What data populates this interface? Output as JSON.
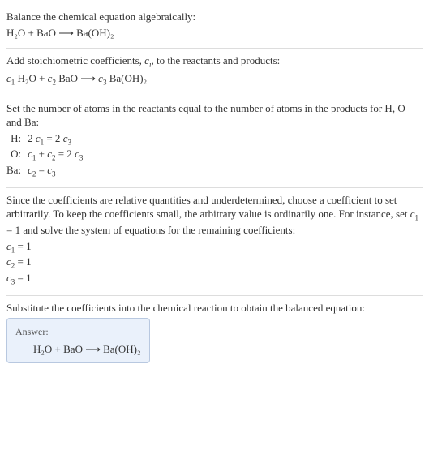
{
  "s1": {
    "prompt": "Balance the chemical equation algebraically:",
    "eqn": "H₂O + BaO ⟶ Ba(OH)₂"
  },
  "s2": {
    "line1a": "Add stoichiometric coefficients, ",
    "ci": "c",
    "ci_sub": "i",
    "line1b": ", to the reactants and products:",
    "eqn_c1": "c",
    "eqn_c1s": "1",
    "eqn_t1": " H₂O + ",
    "eqn_c2": "c",
    "eqn_c2s": "2",
    "eqn_t2": " BaO ⟶ ",
    "eqn_c3": "c",
    "eqn_c3s": "3",
    "eqn_t3": " Ba(OH)₂"
  },
  "s3": {
    "intro": "Set the number of atoms in the reactants equal to the number of atoms in the products for H, O and Ba:",
    "rows": [
      {
        "el": "H:",
        "lhs1": "2 ",
        "c1": "c",
        "c1s": "1",
        "mid": " = 2 ",
        "c2": "c",
        "c2s": "3"
      },
      {
        "el": "O:",
        "c1": "c",
        "c1s": "1",
        "plus": " + ",
        "c2": "c",
        "c2s": "2",
        "mid": " = 2 ",
        "c3": "c",
        "c3s": "3"
      },
      {
        "el": "Ba:",
        "c1": "c",
        "c1s": "2",
        "mid": " = ",
        "c2": "c",
        "c2s": "3"
      }
    ]
  },
  "s4": {
    "p1a": "Since the coefficients are relative quantities and underdetermined, choose a coefficient to set arbitrarily. To keep the coefficients small, the arbitrary value is ordinarily one. For instance, set ",
    "c1": "c",
    "c1s": "1",
    "p1b": " = 1 and solve the system of equations for the remaining coefficients:",
    "vals": [
      {
        "c": "c",
        "cs": "1",
        "rest": " = 1"
      },
      {
        "c": "c",
        "cs": "2",
        "rest": " = 1"
      },
      {
        "c": "c",
        "cs": "3",
        "rest": " = 1"
      }
    ]
  },
  "s5": {
    "text": "Substitute the coefficients into the chemical reaction to obtain the balanced equation:",
    "answer_label": "Answer:",
    "answer_eqn": "H₂O + BaO ⟶ Ba(OH)₂"
  }
}
